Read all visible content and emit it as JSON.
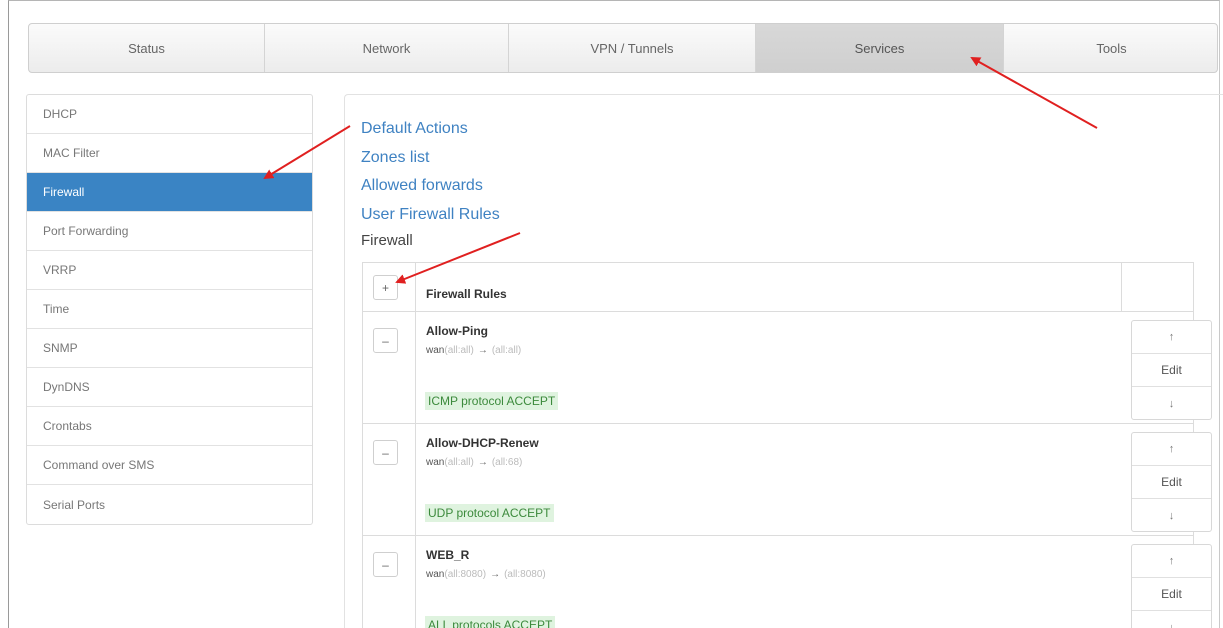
{
  "topnav": {
    "tabs": [
      {
        "label": "Status"
      },
      {
        "label": "Network"
      },
      {
        "label": "VPN / Tunnels"
      },
      {
        "label": "Services"
      },
      {
        "label": "Tools"
      }
    ],
    "active": "Services"
  },
  "sidebar": {
    "items": [
      {
        "label": "DHCP"
      },
      {
        "label": "MAC Filter"
      },
      {
        "label": "Firewall"
      },
      {
        "label": "Port Forwarding"
      },
      {
        "label": "VRRP"
      },
      {
        "label": "Time"
      },
      {
        "label": "SNMP"
      },
      {
        "label": "DynDNS"
      },
      {
        "label": "Crontabs"
      },
      {
        "label": "Command over SMS"
      },
      {
        "label": "Serial Ports"
      }
    ],
    "active": "Firewall"
  },
  "main": {
    "links": [
      "Default Actions",
      "Zones list",
      "Allowed forwards",
      "User Firewall Rules"
    ],
    "section_title": "Firewall",
    "table": {
      "add_label": "+",
      "header": "Firewall Rules",
      "rules": [
        {
          "name": "Allow-Ping",
          "src_zone": "wan",
          "src_detail": "(all:all)",
          "arrow": "→",
          "dst_detail": "(all:all)",
          "badge": "ICMP protocol ACCEPT",
          "remove_label": "–",
          "up_label": "↑",
          "edit_label": "Edit",
          "down_label": "↓"
        },
        {
          "name": "Allow-DHCP-Renew",
          "src_zone": "wan",
          "src_detail": "(all:all)",
          "arrow": "→",
          "dst_detail": "(all:68)",
          "badge": "UDP protocol ACCEPT",
          "remove_label": "–",
          "up_label": "↑",
          "edit_label": "Edit",
          "down_label": "↓"
        },
        {
          "name": "WEB_R",
          "src_zone": "wan",
          "src_detail": "(all:8080)",
          "arrow": "→",
          "dst_detail": "(all:8080)",
          "badge": "ALL protocols ACCEPT",
          "remove_label": "–",
          "up_label": "↑",
          "edit_label": "Edit",
          "down_label": "↓"
        }
      ]
    }
  },
  "annotation_color": "#e02020"
}
